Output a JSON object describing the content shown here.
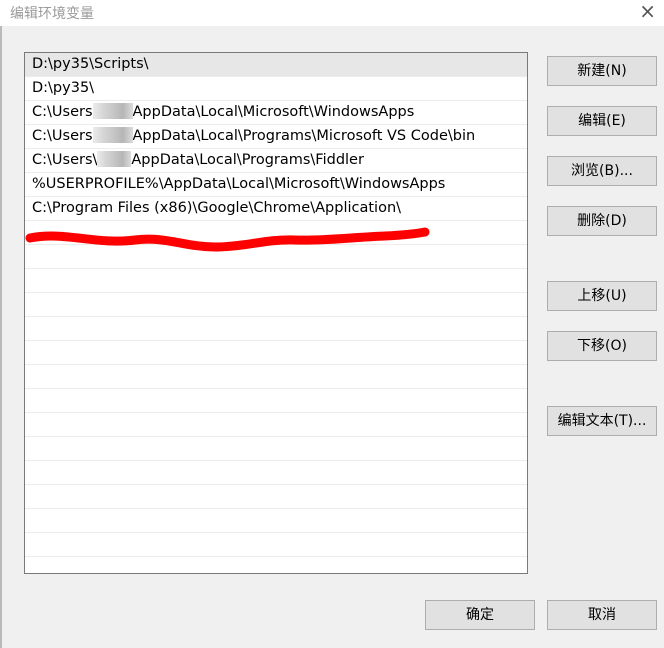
{
  "window": {
    "title": "编辑环境变量",
    "close_glyph": "×"
  },
  "path_list": {
    "items": [
      {
        "before": "D:\\py35\\Scripts\\",
        "after": "",
        "blurred": false
      },
      {
        "before": "D:\\py35\\",
        "after": "",
        "blurred": false
      },
      {
        "before": "C:\\Users",
        "after": "AppData\\Local\\Microsoft\\WindowsApps",
        "blurred": true
      },
      {
        "before": "C:\\Users",
        "after": "AppData\\Local\\Programs\\Microsoft VS Code\\bin",
        "blurred": true
      },
      {
        "before": "C:\\Users\\",
        "after": "AppData\\Local\\Programs\\Fiddler",
        "blurred": true
      },
      {
        "before": "%USERPROFILE%\\AppData\\Local\\Microsoft\\WindowsApps",
        "after": "",
        "blurred": false
      },
      {
        "before": "C:\\Program Files (x86)\\Google\\Chrome\\Application\\",
        "after": "",
        "blurred": false
      }
    ],
    "annotation_color": "#ff0000"
  },
  "buttons": {
    "new": "新建(N)",
    "edit": "编辑(E)",
    "browse": "浏览(B)...",
    "delete": "删除(D)",
    "move_up": "上移(U)",
    "move_down": "下移(O)",
    "edit_text": "编辑文本(T)...",
    "ok": "确定",
    "cancel": "取消"
  }
}
